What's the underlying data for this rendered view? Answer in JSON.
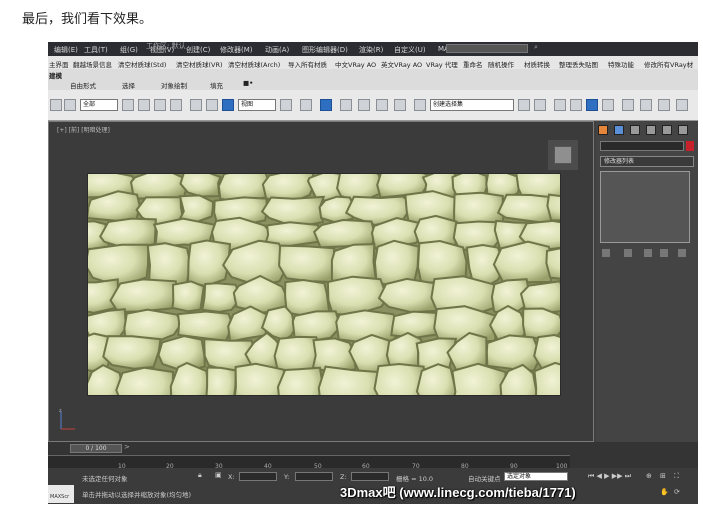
{
  "caption": "最后，我们看下效果。",
  "menu": [
    "编辑(E)",
    "工具(T)",
    "组(G)",
    "视图(V)",
    "创建(C)",
    "修改器(M)",
    "动画(A)",
    "图形编辑器(D)",
    "渲染(R)",
    "自定义(U)",
    "MAXScript(X)",
    "帮助(H)"
  ],
  "title_text": "工作区: 默认",
  "command_buttons": [
    "主界面",
    "翻越场景信息",
    "清空材质球(Std)",
    "清空材质球(VR)",
    "清空材质球(Arch)",
    "导入所有材质",
    "中文VRay AO",
    "英文VRay AO",
    "VRay 代理",
    "重命名",
    "随机操作",
    "材质转换",
    "整理丢失贴图",
    "特殊功能",
    "修改所有VRay材"
  ],
  "ribbon": {
    "label": "建模",
    "tabs": [
      "自由形式",
      "选择",
      "对象绘制",
      "填充"
    ]
  },
  "toolbar": {
    "selection_filter": "全部",
    "reference_coord": "视图",
    "named_selection": "创建选择集"
  },
  "viewport": {
    "label": "[+] [前] [明暗处理]"
  },
  "command_panel": {
    "modifier_list": "修改器列表"
  },
  "timeline": {
    "position": "0 / 100",
    "ticks": [
      "10",
      "20",
      "30",
      "40",
      "50",
      "60",
      "70",
      "80",
      "90",
      "100"
    ]
  },
  "status": {
    "selection": "未选定任何对象",
    "prompt": "单击并拖动以选择并缩放对象(均匀地)",
    "x_label": "X:",
    "y_label": "Y:",
    "z_label": "Z:",
    "grid": "栅格 = 10.0",
    "auto_key": "自动关键点",
    "key_mode": "选定对象",
    "maxscript": "MAXScr"
  },
  "watermark": "3Dmax吧 (www.linecg.com/tieba/1771)",
  "colors": {
    "panel": "#b9bf8c",
    "viewport_bg": "#3b3b3b",
    "active_button": "#2f6fc2",
    "swatch": "#c7212b"
  }
}
